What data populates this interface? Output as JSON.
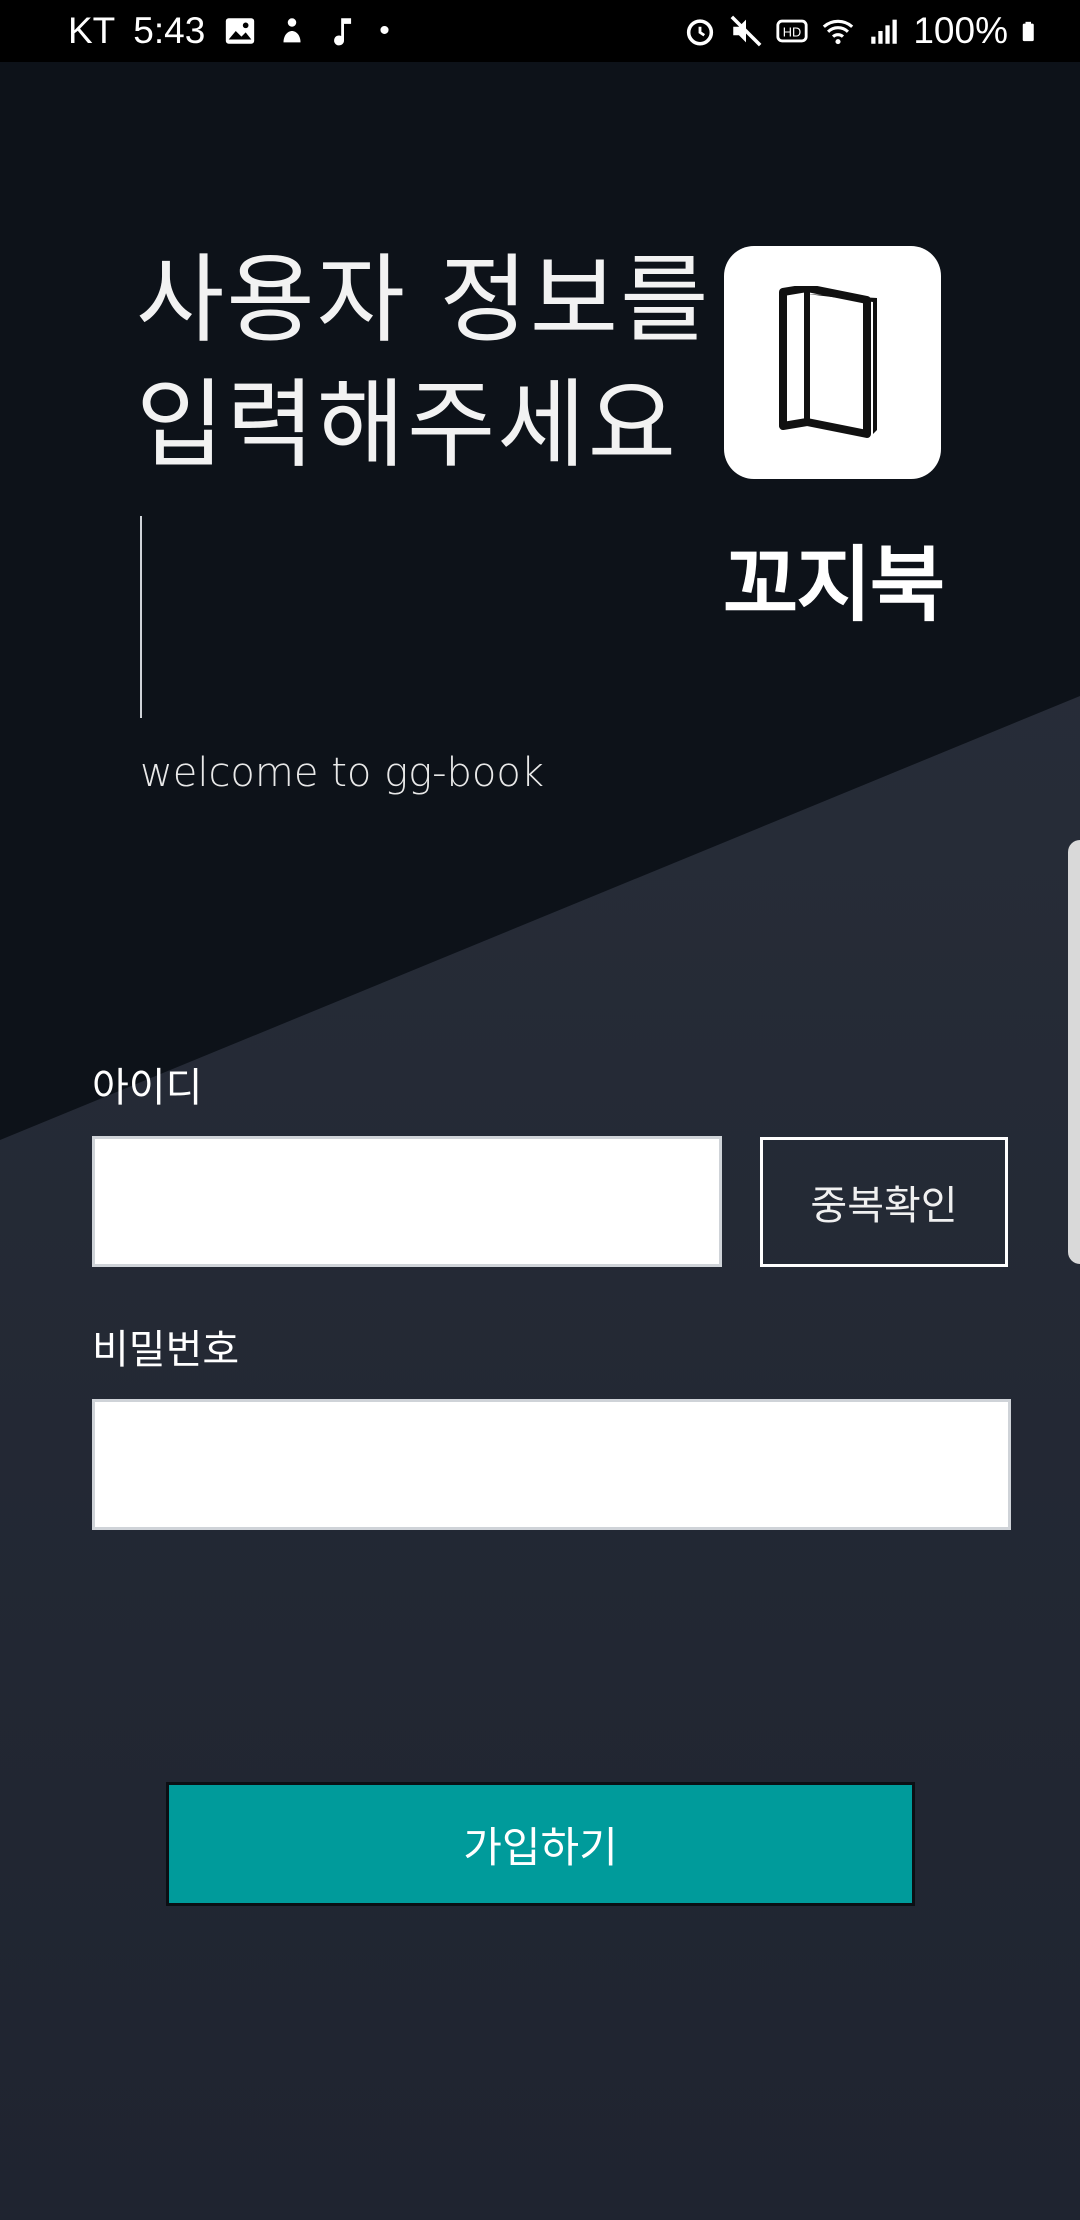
{
  "status_bar": {
    "carrier": "KT",
    "time": "5:43",
    "battery": "100%"
  },
  "header": {
    "title_line1": "사용자 정보를",
    "title_line2": "입력해주세요",
    "subtitle": "welcome to gg-book"
  },
  "brand": {
    "name": "꼬지북"
  },
  "form": {
    "id_label": "아이디",
    "id_value": "",
    "duplicate_check_button": "중복확인",
    "password_label": "비밀번호",
    "password_value": "",
    "submit_button": "가입하기"
  },
  "colors": {
    "top_background": "#0d1219",
    "bottom_background": "#212631",
    "accent": "#009b9b"
  }
}
